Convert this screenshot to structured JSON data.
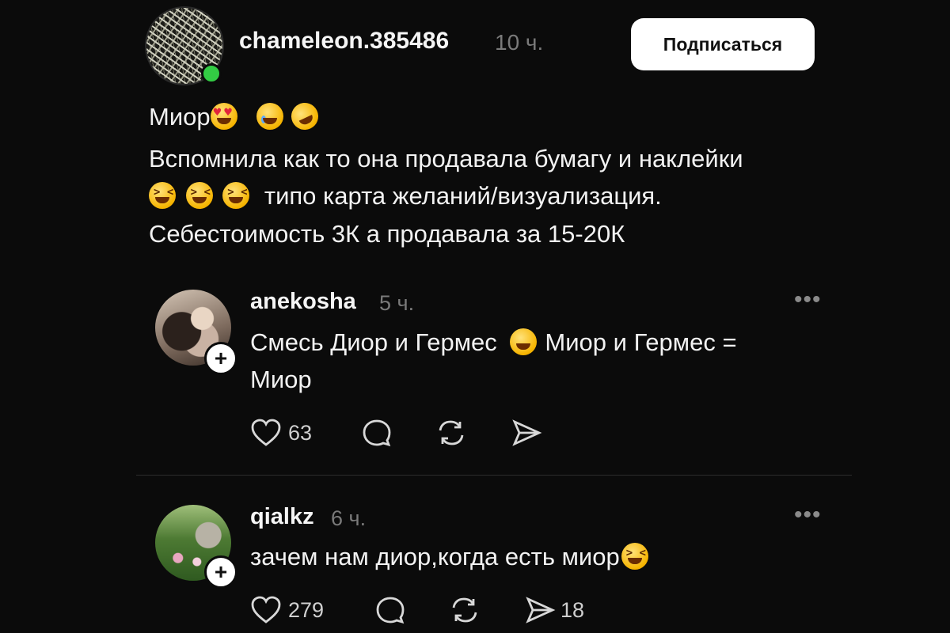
{
  "post": {
    "author": "chameleon.385486",
    "time": "10 ч.",
    "subscribe_label": "Подписаться",
    "title_text": "Миор",
    "line2": "Вспомнила как то она продавала бумагу и наклейки",
    "line3": "типо карта желаний/визуализация.",
    "line4": "Себестоимость 3К а продавала за 15-20К",
    "emojis": [
      "heart-eyes",
      "tear-smile",
      "rofl",
      "squint-laugh",
      "squint-laugh",
      "squint-laugh"
    ]
  },
  "comments": [
    {
      "author": "anekosha",
      "time": "5 ч.",
      "text_line1_a": "Смесь Диор и Гермес",
      "text_line1_b": "Миор и Гермес =",
      "text_line2": "Миор",
      "likes": "63",
      "shares": ""
    },
    {
      "author": "qialkz",
      "time": "6 ч.",
      "text_line1_a": "зачем нам диор,когда есть миор",
      "likes": "279",
      "shares": "18"
    }
  ],
  "ui": {
    "more": "•••",
    "plus": "+"
  },
  "colors": {
    "background": "#0b0b0b",
    "online": "#33cc44",
    "muted": "#7a7a7a"
  }
}
